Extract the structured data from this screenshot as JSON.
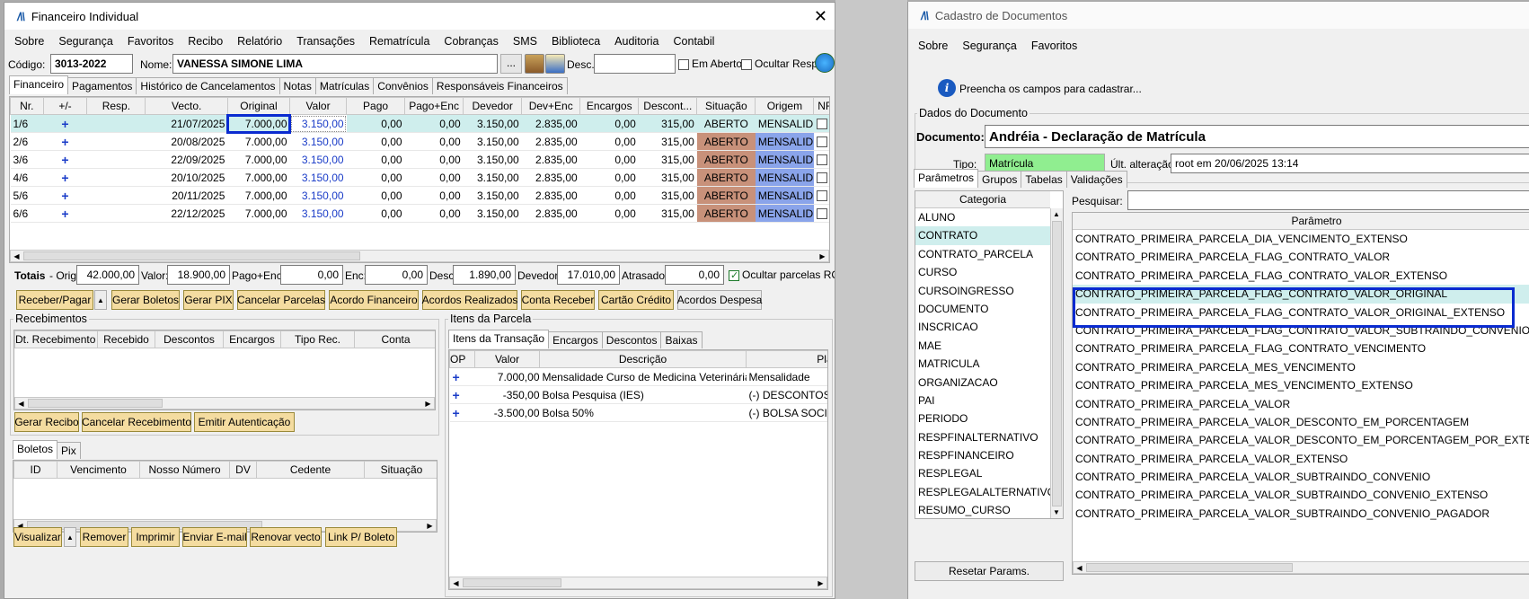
{
  "left": {
    "title": "Financeiro Individual",
    "menu": [
      "Sobre",
      "Segurança",
      "Favoritos",
      "Recibo",
      "Relatório",
      "Transações",
      "Rematrícula",
      "Cobranças",
      "SMS",
      "Biblioteca",
      "Auditoria",
      "Contabil"
    ],
    "codigo_label": "Código:",
    "codigo": "3013-2022",
    "nome_label": "Nome:",
    "nome": "VANESSA SIMONE LIMA",
    "ellipsis": "...",
    "desc_label": "Desc.:",
    "desc_value": "",
    "em_aberto": "Em Aberto",
    "ocultar_resp": "Ocultar Resp.",
    "tabs": [
      "Financeiro",
      "Pagamentos",
      "Histórico de Cancelamentos",
      "Notas",
      "Matrículas",
      "Convênios",
      "Responsáveis Financeiros"
    ],
    "columns": [
      "Nr.",
      "+/-",
      "Resp.",
      "Vecto.",
      "Original",
      "Valor",
      "Pago",
      "Pago+Enc",
      "Devedor",
      "Dev+Enc",
      "Encargos",
      "Descont...",
      "Situação",
      "Origem",
      "NF"
    ],
    "rows": [
      {
        "nr": "1/6",
        "pm": "+",
        "resp": "",
        "vecto": "21/07/2025",
        "original": "7.000,00",
        "valor": "3.150,00",
        "pago": "0,00",
        "pagoenc": "0,00",
        "devedor": "3.150,00",
        "devenc": "2.835,00",
        "encargos": "0,00",
        "desconto": "315,00",
        "situacao": "ABERTO",
        "origem": "MENSALID..."
      },
      {
        "nr": "2/6",
        "pm": "+",
        "resp": "",
        "vecto": "20/08/2025",
        "original": "7.000,00",
        "valor": "3.150,00",
        "pago": "0,00",
        "pagoenc": "0,00",
        "devedor": "3.150,00",
        "devenc": "2.835,00",
        "encargos": "0,00",
        "desconto": "315,00",
        "situacao": "ABERTO",
        "origem": "MENSALID..."
      },
      {
        "nr": "3/6",
        "pm": "+",
        "resp": "",
        "vecto": "22/09/2025",
        "original": "7.000,00",
        "valor": "3.150,00",
        "pago": "0,00",
        "pagoenc": "0,00",
        "devedor": "3.150,00",
        "devenc": "2.835,00",
        "encargos": "0,00",
        "desconto": "315,00",
        "situacao": "ABERTO",
        "origem": "MENSALID..."
      },
      {
        "nr": "4/6",
        "pm": "+",
        "resp": "",
        "vecto": "20/10/2025",
        "original": "7.000,00",
        "valor": "3.150,00",
        "pago": "0,00",
        "pagoenc": "0,00",
        "devedor": "3.150,00",
        "devenc": "2.835,00",
        "encargos": "0,00",
        "desconto": "315,00",
        "situacao": "ABERTO",
        "origem": "MENSALID..."
      },
      {
        "nr": "5/6",
        "pm": "+",
        "resp": "",
        "vecto": "20/11/2025",
        "original": "7.000,00",
        "valor": "3.150,00",
        "pago": "0,00",
        "pagoenc": "0,00",
        "devedor": "3.150,00",
        "devenc": "2.835,00",
        "encargos": "0,00",
        "desconto": "315,00",
        "situacao": "ABERTO",
        "origem": "MENSALID..."
      },
      {
        "nr": "6/6",
        "pm": "+",
        "resp": "",
        "vecto": "22/12/2025",
        "original": "7.000,00",
        "valor": "3.150,00",
        "pago": "0,00",
        "pagoenc": "0,00",
        "devedor": "3.150,00",
        "devenc": "2.835,00",
        "encargos": "0,00",
        "desconto": "315,00",
        "situacao": "ABERTO",
        "origem": "MENSALID..."
      }
    ],
    "totais": {
      "label": "Totais",
      "orig_label": "- Orig:",
      "orig": "42.000,00",
      "valor_label": "Valor:",
      "valor": "18.900,00",
      "pagoenc_label": "Pago+Enc:",
      "pagoenc": "0,00",
      "enc_label": "Enc:",
      "enc": "0,00",
      "desc_label": "Desc:",
      "desc": "1.890,00",
      "devedor_label": "Devedor:",
      "devedor": "17.010,00",
      "atrasado_label": "Atrasado:",
      "atrasado": "0,00",
      "ocultar_rc": "Ocultar parcelas RC"
    },
    "actions": [
      "Receber/Pagar",
      "Gerar Boletos",
      "Gerar PIX",
      "Cancelar Parcelas",
      "Acordo Financeiro",
      "Acordos Realizados",
      "Conta Receber",
      "Cartão Crédito",
      "Acordos Despesa"
    ],
    "recebimentos": {
      "title": "Recebimentos",
      "columns": [
        "Dt. Recebimento",
        "Recebido",
        "Descontos",
        "Encargos",
        "Tipo Rec.",
        "Conta"
      ],
      "buttons": [
        "Gerar Recibo",
        "Cancelar Recebimento",
        "Emitir Autenticação"
      ]
    },
    "itens": {
      "title": "Itens da Parcela",
      "tabs": [
        "Itens da Transação",
        "Encargos",
        "Descontos",
        "Baixas"
      ],
      "columns": [
        "OP",
        "Valor",
        "Descrição",
        "Plano"
      ],
      "rows": [
        {
          "op": "+",
          "valor": "7.000,00",
          "descricao": "Mensalidade Curso de Medicina Veterinária",
          "plano": "Mensalidade"
        },
        {
          "op": "+",
          "valor": "-350,00",
          "descricao": "Bolsa Pesquisa (IES)",
          "plano": "(-) DESCONTOS D"
        },
        {
          "op": "+",
          "valor": "-3.500,00",
          "descricao": "Bolsa 50%",
          "plano": "(-) BOLSA SOCIAL"
        }
      ]
    },
    "boletos": {
      "tabs": [
        "Boletos",
        "Pix"
      ],
      "columns": [
        "ID",
        "Vencimento",
        "Nosso Número",
        "DV",
        "Cedente",
        "Situação"
      ],
      "buttons": [
        "Visualizar",
        "Remover",
        "Imprimir",
        "Enviar E-mail",
        "Renovar vecto",
        "Link P/ Boleto"
      ]
    }
  },
  "right": {
    "title": "Cadastro de Documentos",
    "menu": [
      "Sobre",
      "Segurança",
      "Favoritos"
    ],
    "info": "Preencha os campos para cadastrar...",
    "group_title": "Dados do Documento",
    "documento_label": "Documento:",
    "documento": "Andréia - Declaração de Matrícula",
    "tipo_label": "Tipo:",
    "tipo": "Matrícula",
    "ult_label": "Últ. alteração:",
    "ult": "root em 20/06/2025 13:14",
    "tabs": [
      "Parâmetros",
      "Grupos",
      "Tabelas",
      "Validações"
    ],
    "categoria_header": "Categoria",
    "categorias": [
      "ALUNO",
      "CONTRATO",
      "CONTRATO_PARCELA",
      "CURSO",
      "CURSOINGRESSO",
      "DOCUMENTO",
      "INSCRICAO",
      "MAE",
      "MATRICULA",
      "ORGANIZACAO",
      "PAI",
      "PERIODO",
      "RESPFINALTERNATIVO",
      "RESPFINANCEIRO",
      "RESPLEGAL",
      "RESPLEGALALTERNATIVO",
      "RESUMO_CURSO"
    ],
    "pesquisar_label": "Pesquisar:",
    "parametro_header": "Parâmetro",
    "parametros": [
      "CONTRATO_PRIMEIRA_PARCELA_DIA_VENCIMENTO_EXTENSO",
      "CONTRATO_PRIMEIRA_PARCELA_FLAG_CONTRATO_VALOR",
      "CONTRATO_PRIMEIRA_PARCELA_FLAG_CONTRATO_VALOR_EXTENSO",
      "CONTRATO_PRIMEIRA_PARCELA_FLAG_CONTRATO_VALOR_ORIGINAL",
      "CONTRATO_PRIMEIRA_PARCELA_FLAG_CONTRATO_VALOR_ORIGINAL_EXTENSO",
      "CONTRATO_PRIMEIRA_PARCELA_FLAG_CONTRATO_VALOR_SUBTRAINDO_CONVENIO",
      "CONTRATO_PRIMEIRA_PARCELA_FLAG_CONTRATO_VENCIMENTO",
      "CONTRATO_PRIMEIRA_PARCELA_MES_VENCIMENTO",
      "CONTRATO_PRIMEIRA_PARCELA_MES_VENCIMENTO_EXTENSO",
      "CONTRATO_PRIMEIRA_PARCELA_VALOR",
      "CONTRATO_PRIMEIRA_PARCELA_VALOR_DESCONTO_EM_PORCENTAGEM",
      "CONTRATO_PRIMEIRA_PARCELA_VALOR_DESCONTO_EM_PORCENTAGEM_POR_EXTENSO",
      "CONTRATO_PRIMEIRA_PARCELA_VALOR_EXTENSO",
      "CONTRATO_PRIMEIRA_PARCELA_VALOR_SUBTRAINDO_CONVENIO",
      "CONTRATO_PRIMEIRA_PARCELA_VALOR_SUBTRAINDO_CONVENIO_EXTENSO",
      "CONTRATO_PRIMEIRA_PARCELA_VALOR_SUBTRAINDO_CONVENIO_PAGADOR"
    ],
    "resetar": "Resetar Params."
  },
  "colors": {
    "highlight": "#0a2bd0",
    "situacao": "#c8917a",
    "origem": "#8aa4ea",
    "selected": "#cfeeed",
    "tipo": "#90ee90",
    "action_button": "#f4dca0"
  }
}
